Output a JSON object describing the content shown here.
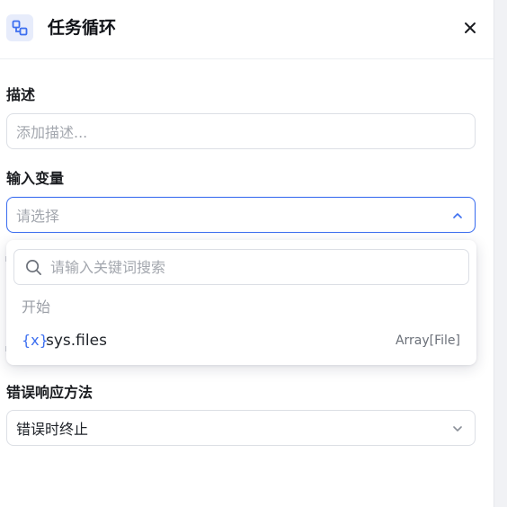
{
  "header": {
    "title": "任务循环",
    "icon": "loop-nodes-icon",
    "close_label": "×"
  },
  "description": {
    "label": "描述",
    "placeholder": "添加描述..."
  },
  "input_variable": {
    "label": "输入变量",
    "placeholder": "请选择",
    "state": "open"
  },
  "dropdown": {
    "search_placeholder": "请输入关键词搜索",
    "group_label": "开始",
    "options": [
      {
        "icon": "{x}",
        "name": "sys.files",
        "type": "Array[File]"
      }
    ]
  },
  "error_handling": {
    "label": "错误响应方法",
    "value": "错误时终止"
  },
  "colors": {
    "accent": "#3d6ff0",
    "icon_bg": "#e7ecfb"
  }
}
